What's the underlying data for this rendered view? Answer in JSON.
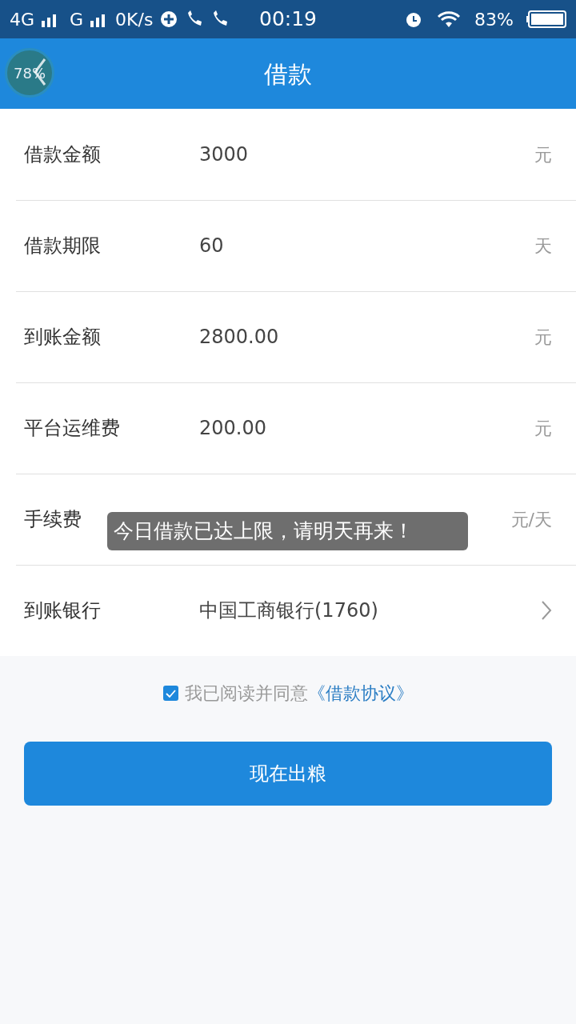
{
  "status_bar": {
    "network_1": "4G",
    "network_2": "G",
    "speed": "0K/s",
    "time": "00:19",
    "battery": "83%"
  },
  "header": {
    "title": "借款",
    "floating_badge": "78%"
  },
  "rows": [
    {
      "kind": "field",
      "label": "借款金额",
      "value": "3000",
      "unit": "元"
    },
    {
      "kind": "field",
      "label": "借款期限",
      "value": "60",
      "unit": "天"
    },
    {
      "kind": "field",
      "label": "到账金额",
      "value": "2800.00",
      "unit": "元"
    },
    {
      "kind": "field",
      "label": "平台运维费",
      "value": "200.00",
      "unit": "元"
    },
    {
      "kind": "field",
      "label": "手续费",
      "unit": "元/天"
    },
    {
      "kind": "select",
      "label": "到账银行",
      "value": "中国工商银行(1760)"
    }
  ],
  "agreement": {
    "checked": true,
    "text": "我已阅读并同意",
    "link": "《借款协议》"
  },
  "submit_button": "现在出粮",
  "toast": "今日借款已达上限，请明天再来！"
}
